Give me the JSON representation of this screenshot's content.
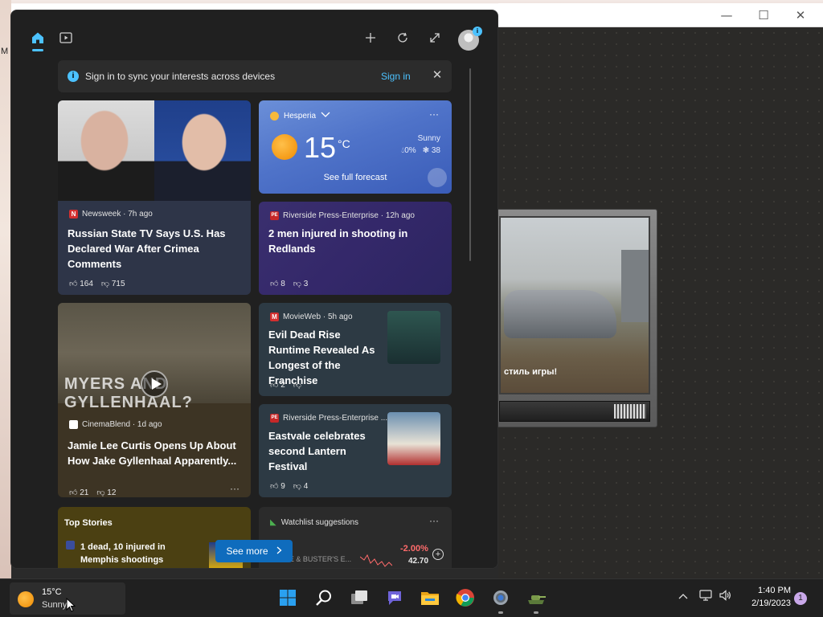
{
  "background": {
    "left_text": "M",
    "window_controls": {
      "minimize": "—",
      "maximize": "☐",
      "close": "✕"
    },
    "game_caption": "стиль игры!"
  },
  "panel": {
    "header_icons": [
      "home-icon",
      "video-icon",
      "add-icon",
      "refresh-icon",
      "expand-icon",
      "profile-icon"
    ],
    "profile_badge": "i",
    "signin": {
      "info": "i",
      "text": "Sign in to sync your interests across devices",
      "link": "Sign in",
      "close": "✕"
    },
    "cards": {
      "newsweek": {
        "source": "Newsweek · 7h ago",
        "logo": "N",
        "logo_color": "#d32f2f",
        "headline": "Russian State TV Says U.S. Has Declared War After Crimea Comments",
        "likes": "164",
        "dislikes": "715"
      },
      "weather": {
        "location": "Hesperia",
        "more": "···",
        "temp": "15",
        "unit": "°C",
        "condition": "Sunny",
        "precip": "0%",
        "aqi": "38",
        "forecast": "See full forecast"
      },
      "river1": {
        "source": "Riverside Press-Enterprise · 12h ago",
        "logo": "PE",
        "headline": "2 men injured in shooting in Redlands",
        "likes": "8",
        "dislikes": "3"
      },
      "myers": {
        "overlay": "MYERS AND GYLLENHAAL?",
        "source": "CinemaBlend · 1d ago",
        "headline": "Jamie Lee Curtis Opens Up About How Jake Gyllenhaal Apparently...",
        "likes": "21",
        "dislikes": "12",
        "more": "···"
      },
      "movieweb": {
        "source": "MovieWeb · 5h ago",
        "logo": "M",
        "headline": "Evil Dead Rise Runtime Revealed As Longest of the Franchise",
        "likes": "2",
        "dislikes": ""
      },
      "river2": {
        "source": "Riverside Press-Enterprise ...",
        "logo": "PE",
        "headline": "Eastvale celebrates second Lantern Festival",
        "likes": "9",
        "dislikes": "4"
      },
      "topstories": {
        "title": "Top Stories",
        "headline": "1 dead, 10 injured in Memphis shootings"
      },
      "watchlist": {
        "title": "Watchlist suggestions",
        "more": "···",
        "ticker": "DAVE & BUSTER'S E...",
        "change": "-2.00%",
        "price": "42.70",
        "add": "+"
      }
    },
    "see_more": "See more"
  },
  "taskbar": {
    "weather_temp": "15°C",
    "weather_cond": "Sunny",
    "apps": [
      "windows-start-icon",
      "search-icon",
      "task-view-icon",
      "chat-icon",
      "file-explorer-icon",
      "chrome-icon",
      "settings-icon",
      "game-icon"
    ],
    "time": "1:40 PM",
    "date": "2/19/2023",
    "notifications": "1"
  }
}
